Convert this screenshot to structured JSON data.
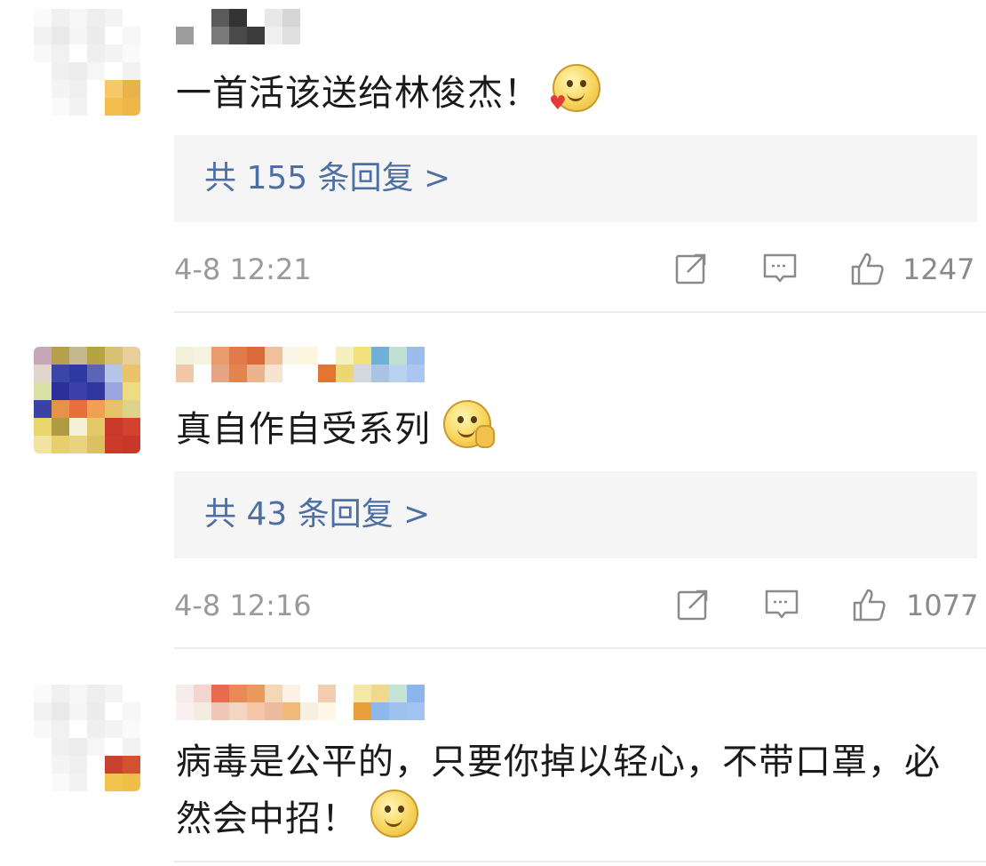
{
  "comments": [
    {
      "text": "一首活该送给林俊杰！",
      "emoji": "heart-eyes-emoji",
      "reply_link": "共 155 条回复 >",
      "time": "4-8 12:21",
      "likes": "1247"
    },
    {
      "text": "真自作自受系列",
      "emoji": "hand-on-face-emoji",
      "reply_link": "共 43 条回复 >",
      "time": "4-8 12:16",
      "likes": "1077"
    },
    {
      "text": "病毒是公平的，只要你掉以轻心，不带口罩，必然会中招！",
      "emoji": "smile-emoji"
    }
  ],
  "icons": {
    "share": "share-icon",
    "comment": "comment-icon",
    "like": "thumbs-up-icon"
  },
  "colors": {
    "reply_link": "#4e6fa3",
    "reply_box_bg": "#f5f5f5",
    "meta_text": "#9a9a9a"
  }
}
